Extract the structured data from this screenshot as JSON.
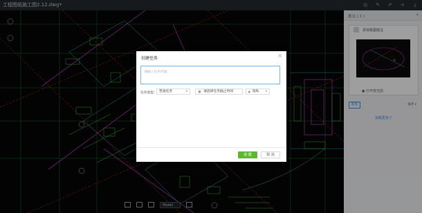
{
  "window": {
    "title": "工程图纸施工图2.12.dwg",
    "caret": "▾"
  },
  "top_icons": [
    "target-icon",
    "edit-icon",
    "pen-icon",
    "share-icon",
    "download-icon"
  ],
  "cad_toolbar": {
    "model_label": "Model",
    "icons": [
      "fit-screen-icon",
      "upload-icon",
      "measure-icon",
      "edit-icon"
    ]
  },
  "right_panel": {
    "header": "批注 ( 1 )",
    "card_title": "添加看图批注",
    "card_status": "● 已开放当前",
    "new_button": "新增",
    "sort_label": "排序 ▾",
    "load_more": "加载更多了"
  },
  "modal": {
    "title": "创建任务",
    "close": "×",
    "textarea_placeholder": "请输入任务内容",
    "type_label": "任务类型：",
    "type_value": "普通任务",
    "deadline_placeholder": "请选择任务截止时间",
    "privacy_value": "隐私",
    "confirm_button": "创 建",
    "cancel_button": "取 消"
  }
}
